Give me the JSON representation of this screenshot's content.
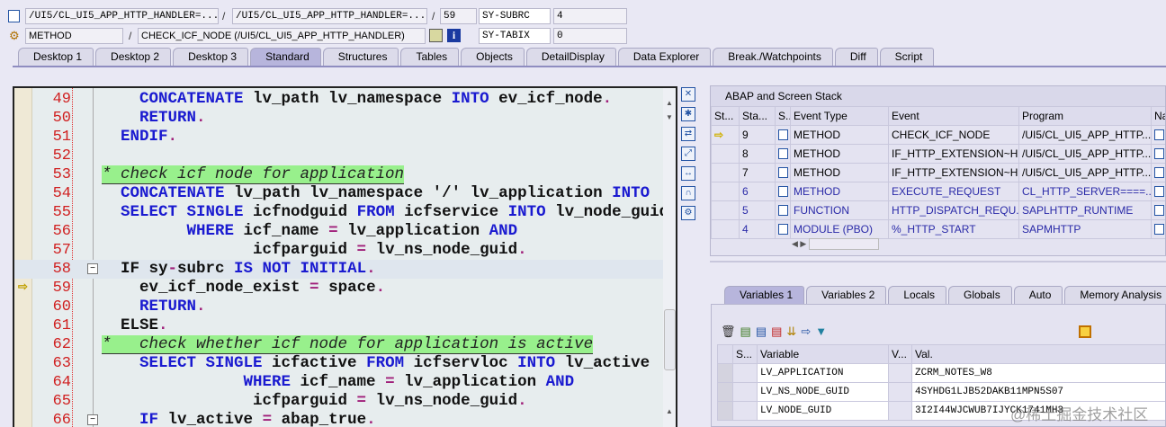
{
  "header": {
    "program": "/UI5/CL_UI5_APP_HTTP_HANDLER=...",
    "include": "/UI5/CL_UI5_APP_HTTP_HANDLER=...",
    "line": "59",
    "event_type": "METHOD",
    "event": "CHECK_ICF_NODE (/UI5/CL_UI5_APP_HTTP_HANDLER)",
    "sysvars": [
      {
        "name": "SY-SUBRC",
        "value": "4"
      },
      {
        "name": "SY-TABIX",
        "value": "0"
      }
    ],
    "separator": "/"
  },
  "main_tabs": [
    "Desktop 1",
    "Desktop 2",
    "Desktop 3",
    "Standard",
    "Structures",
    "Tables",
    "Objects",
    "DetailDisplay",
    "Data Explorer",
    "Break./Watchpoints",
    "Diff",
    "Script"
  ],
  "active_main_tab": "Standard",
  "editor": {
    "current_line": 59,
    "lines": [
      {
        "n": "49",
        "seg": [
          [
            "t",
            "    "
          ],
          [
            "kw",
            "CONCATENATE"
          ],
          [
            "t",
            " lv_path lv_namespace "
          ],
          [
            "kw",
            "INTO"
          ],
          [
            "t",
            " ev_icf_node"
          ],
          [
            "op",
            "."
          ]
        ]
      },
      {
        "n": "50",
        "seg": [
          [
            "t",
            "    "
          ],
          [
            "kw",
            "RETURN"
          ],
          [
            "op",
            "."
          ]
        ]
      },
      {
        "n": "51",
        "seg": [
          [
            "t",
            "  "
          ],
          [
            "kw",
            "ENDIF"
          ],
          [
            "op",
            "."
          ]
        ]
      },
      {
        "n": "52",
        "seg": []
      },
      {
        "n": "53",
        "seg": [
          [
            "cm",
            "* check icf node for application"
          ]
        ]
      },
      {
        "n": "54",
        "seg": [
          [
            "t",
            "  "
          ],
          [
            "kw",
            "CONCATENATE"
          ],
          [
            "t",
            " lv_path lv_namespace '/' lv_application "
          ],
          [
            "kw",
            "INTO"
          ]
        ]
      },
      {
        "n": "55",
        "seg": [
          [
            "t",
            "  "
          ],
          [
            "kw",
            "SELECT SINGLE"
          ],
          [
            "t",
            " icfnodguid "
          ],
          [
            "kw",
            "FROM"
          ],
          [
            "t",
            " icfservice "
          ],
          [
            "kw",
            "INTO"
          ],
          [
            "t",
            " lv_node_guid"
          ]
        ]
      },
      {
        "n": "56",
        "seg": [
          [
            "t",
            "         "
          ],
          [
            "kw",
            "WHERE"
          ],
          [
            "t",
            " icf_name "
          ],
          [
            "op",
            "="
          ],
          [
            "t",
            " lv_application "
          ],
          [
            "kw",
            "AND"
          ]
        ]
      },
      {
        "n": "57",
        "seg": [
          [
            "t",
            "                icfparguid "
          ],
          [
            "op",
            "="
          ],
          [
            "t",
            " lv_ns_node_guid"
          ],
          [
            "op",
            "."
          ]
        ]
      },
      {
        "n": "58",
        "seg": [
          [
            "t",
            "  IF sy"
          ],
          [
            "op",
            "-"
          ],
          [
            "t",
            "subrc "
          ],
          [
            "kw",
            "IS NOT INITIAL"
          ],
          [
            "op",
            "."
          ]
        ]
      },
      {
        "n": "59",
        "seg": [
          [
            "t",
            "    ev_icf_node_exist "
          ],
          [
            "op",
            "="
          ],
          [
            "t",
            " space"
          ],
          [
            "op",
            "."
          ]
        ]
      },
      {
        "n": "60",
        "seg": [
          [
            "t",
            "    "
          ],
          [
            "kw",
            "RETURN"
          ],
          [
            "op",
            "."
          ]
        ]
      },
      {
        "n": "61",
        "seg": [
          [
            "t",
            "  ELSE"
          ],
          [
            "op",
            "."
          ]
        ]
      },
      {
        "n": "62",
        "seg": [
          [
            "cm",
            "*   check whether icf node for application is active"
          ]
        ]
      },
      {
        "n": "63",
        "seg": [
          [
            "t",
            "    "
          ],
          [
            "kw",
            "SELECT SINGLE"
          ],
          [
            "t",
            " icfactive "
          ],
          [
            "kw",
            "FROM"
          ],
          [
            "t",
            " icfservloc "
          ],
          [
            "kw",
            "INTO"
          ],
          [
            "t",
            " lv_active"
          ]
        ]
      },
      {
        "n": "64",
        "seg": [
          [
            "t",
            "               "
          ],
          [
            "kw",
            "WHERE"
          ],
          [
            "t",
            " icf_name "
          ],
          [
            "op",
            "="
          ],
          [
            "t",
            " lv_application "
          ],
          [
            "kw",
            "AND"
          ]
        ]
      },
      {
        "n": "65",
        "seg": [
          [
            "t",
            "                icfparguid "
          ],
          [
            "op",
            "="
          ],
          [
            "t",
            " lv_ns_node_guid"
          ],
          [
            "op",
            "."
          ]
        ]
      },
      {
        "n": "66",
        "seg": [
          [
            "t",
            "    "
          ],
          [
            "kw",
            "IF"
          ],
          [
            "t",
            " lv_active "
          ],
          [
            "op",
            "="
          ],
          [
            "t",
            " abap_true"
          ],
          [
            "op",
            "."
          ]
        ]
      }
    ]
  },
  "stack": {
    "title": "ABAP and Screen Stack",
    "columns": [
      "St...",
      "Sta...",
      "S..",
      "Event Type",
      "Event",
      "Program",
      "Na"
    ],
    "rows": [
      {
        "current": true,
        "level": "9",
        "type": "METHOD",
        "event": "CHECK_ICF_NODE",
        "program": "/UI5/CL_UI5_APP_HTTP...",
        "blue": false
      },
      {
        "current": false,
        "level": "8",
        "type": "METHOD",
        "event": "IF_HTTP_EXTENSION~H...",
        "program": "/UI5/CL_UI5_APP_HTTP...",
        "blue": false
      },
      {
        "current": false,
        "level": "7",
        "type": "METHOD",
        "event": "IF_HTTP_EXTENSION~H...",
        "program": "/UI5/CL_UI5_APP_HTTP...",
        "blue": false
      },
      {
        "current": false,
        "level": "6",
        "type": "METHOD",
        "event": "EXECUTE_REQUEST",
        "program": "CL_HTTP_SERVER====...",
        "blue": true
      },
      {
        "current": false,
        "level": "5",
        "type": "FUNCTION",
        "event": "HTTP_DISPATCH_REQU...",
        "program": "SAPLHTTP_RUNTIME",
        "blue": true
      },
      {
        "current": false,
        "level": "4",
        "type": "MODULE (PBO)",
        "event": "%_HTTP_START",
        "program": "SAPMHTTP",
        "blue": true
      }
    ]
  },
  "var_tabs": [
    "Variables 1",
    "Variables 2",
    "Locals",
    "Globals",
    "Auto",
    "Memory Analysis"
  ],
  "active_var_tab": "Variables 1",
  "variables": {
    "columns": [
      "S...",
      "Variable",
      "V...",
      "Val."
    ],
    "rows": [
      {
        "name": "LV_APPLICATION",
        "value": "ZCRM_NOTES_W8"
      },
      {
        "name": "LV_NS_NODE_GUID",
        "value": "4SYHDG1LJB52DAKB11MPN5S07"
      },
      {
        "name": "LV_NODE_GUID",
        "value": "3I2I44WJCWUB7IJYCK1741MH3"
      }
    ]
  },
  "watermark": "@稀土掘金技术社区"
}
